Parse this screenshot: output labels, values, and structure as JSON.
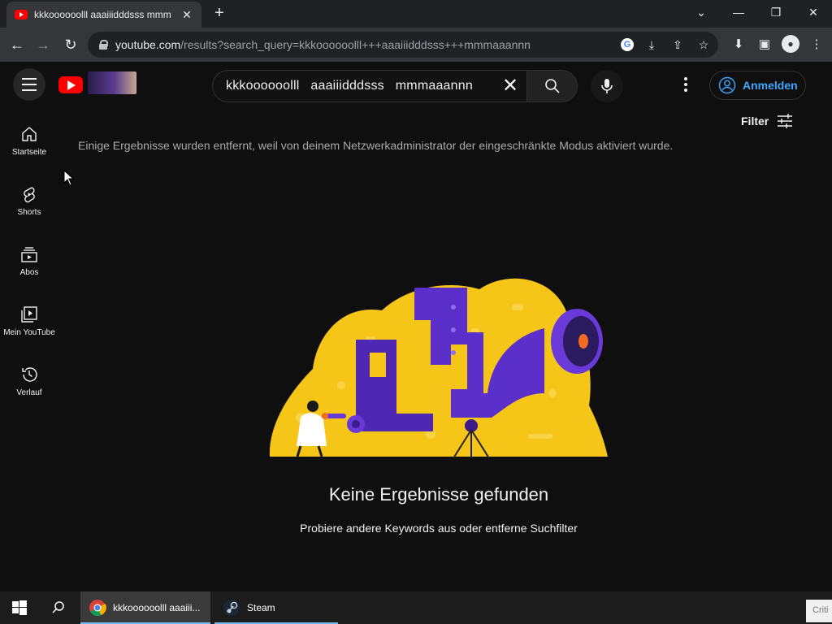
{
  "browser": {
    "tab_title": "kkkoooooolll aaaiiidddsss mmm",
    "url_host": "youtube.com",
    "url_path": "/results?search_query=kkkoooooolll+++aaaiiidddsss+++mmmaaannn",
    "new_tab_label": "+",
    "window_controls": [
      "chevron-down-icon",
      "minimize-icon",
      "restore-icon",
      "close-icon"
    ]
  },
  "youtube": {
    "search_query": "kkkoooooolll   aaaiiidddsss   mmmaaannn",
    "signin_label": "Anmelden",
    "filter_label": "Filter",
    "sidebar": [
      {
        "label": "Startseite",
        "icon": "home-icon"
      },
      {
        "label": "Shorts",
        "icon": "shorts-icon"
      },
      {
        "label": "Abos",
        "icon": "subscriptions-icon"
      },
      {
        "label": "Mein YouTube",
        "icon": "library-icon"
      },
      {
        "label": "Verlauf",
        "icon": "history-icon"
      }
    ],
    "restricted_notice": "Einige Ergebnisse wurden entfernt, weil von deinem Netzwerkadministrator der eingeschränkte Modus aktiviert wurde.",
    "no_results_title": "Keine Ergebnisse gefunden",
    "no_results_subtitle": "Probiere andere Keywords aus oder entferne Suchfilter"
  },
  "taskbar": {
    "chrome_label": "kkkoooooolll aaaiii...",
    "steam_label": "Steam",
    "tray_text": "Criti"
  },
  "colors": {
    "youtube_red": "#ff0000",
    "link_blue": "#3ea6ff",
    "illustration_yellow": "#f5c518",
    "illustration_purple": "#5b2fc9"
  }
}
